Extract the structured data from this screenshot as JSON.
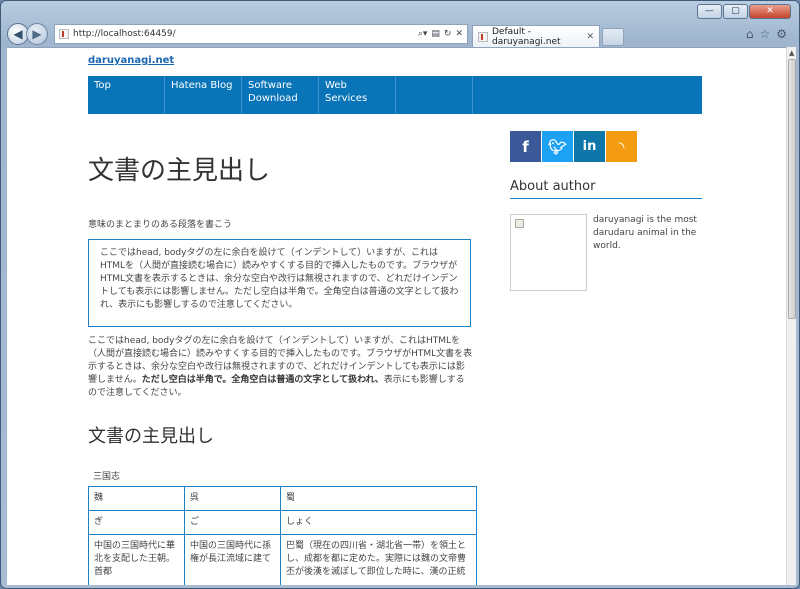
{
  "browser": {
    "address": "http://localhost:64459/",
    "tab_title": "Default - daruyanagi.net"
  },
  "site": {
    "title": "daruyanagi.net",
    "menu": [
      {
        "label": "Top"
      },
      {
        "label": "Hatena Blog"
      },
      {
        "label": "Software\nDownload"
      },
      {
        "label": "Web Services"
      },
      {
        "label": ""
      }
    ]
  },
  "main": {
    "h1": "文書の主見出し",
    "lead": "意味のまとまりのある段落を書こう",
    "quote": "ここではhead, bodyタグの左に余白を設けて（インデントして）いますが、これはHTMLを（人間が直接読む場合に）読みやすくする目的で挿入したものです。ブラウザがHTML文書を表示するときは、余分な空白や改行は無視されますので、どれだけインデントしても表示には影響しません。ただし空白は半角で。全角空白は普通の文字として扱われ、表示にも影響しするので注意してください。",
    "para_a": "ここではhead, bodyタグの左に余白を設けて（インデントして）いますが、これはHTMLを（人間が直接読む場合に）読みやすくする目的で挿入したものです。ブラウザがHTML文書を表示するときは、余分な空白や改行は無視されますので、どれだけインデントしても表示には影響しません。",
    "para_bold": "ただし空白は半角で。全角空白は普通の文字として扱われ、",
    "para_b": "表示にも影響しするので注意してください。",
    "h2": "文書の主見出し",
    "table_caption": "三国志",
    "table": {
      "rows": [
        [
          "魏",
          "呉",
          "蜀"
        ],
        [
          "ぎ",
          "ご",
          "しょく"
        ],
        [
          "中国の三国時代に華北を支配した王朝。首都",
          "中国の三国時代に孫権が長江流域に建て",
          "巴蜀（現在の四川省・湖北省一帯）を領土とし、成都を都に定めた。実際には魏の文帝曹丕が後漢を滅ぼして即位した時に、漢の正統"
        ]
      ]
    }
  },
  "sidebar": {
    "about_title": "About author",
    "bio": "daruyanagi is the most darudaru animal in the world."
  }
}
